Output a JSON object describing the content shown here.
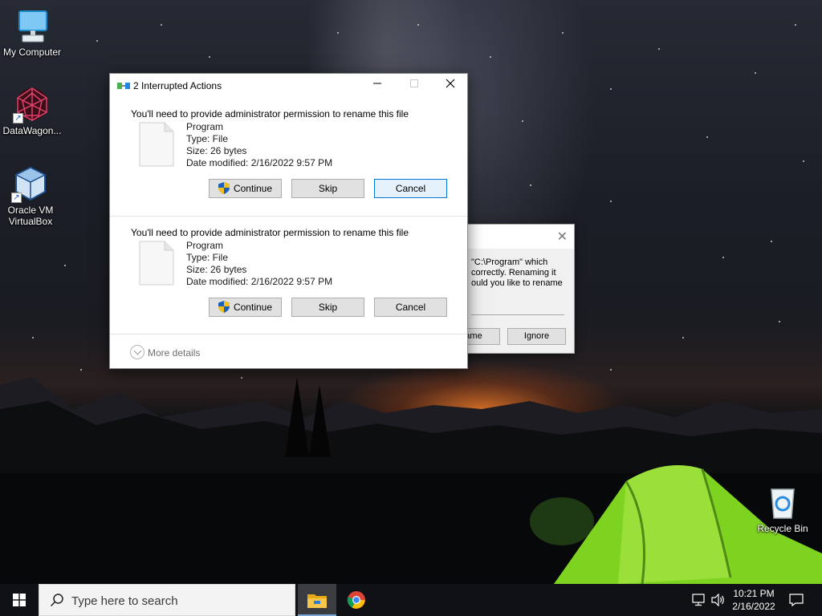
{
  "desktop": {
    "icons": [
      {
        "label": "My Computer"
      },
      {
        "label": "DataWagon..."
      },
      {
        "label": "Oracle VM VirtualBox"
      },
      {
        "label": "Recycle Bin"
      }
    ]
  },
  "background_dialog": {
    "message": "\"C:\\Program\" which correctly.  Renaming it ould you like to rename",
    "rename_button": "ame",
    "ignore_button": "Ignore"
  },
  "dialog": {
    "title": "2 Interrupted Actions",
    "conflicts": [
      {
        "heading": "You'll need to provide administrator permission to rename this file",
        "name": "Program",
        "type": "Type: File",
        "size": "Size: 26 bytes",
        "modified": "Date modified: 2/16/2022 9:57 PM",
        "continue_label": "Continue",
        "skip_label": "Skip",
        "cancel_label": "Cancel"
      },
      {
        "heading": "You'll need to provide administrator permission to rename this file",
        "name": "Program",
        "type": "Type: File",
        "size": "Size: 26 bytes",
        "modified": "Date modified: 2/16/2022 9:57 PM",
        "continue_label": "Continue",
        "skip_label": "Skip",
        "cancel_label": "Cancel"
      }
    ],
    "more_details": "More details"
  },
  "taskbar": {
    "search_placeholder": "Type here to search",
    "apps": [
      {
        "icon": "file-explorer-icon",
        "active": true
      },
      {
        "icon": "chrome-icon",
        "active": false
      }
    ],
    "time": "10:21 PM",
    "date": "2/16/2022"
  },
  "colors": {
    "accent": "#0078d7",
    "button_face": "#e1e1e1",
    "taskbar": "#101114",
    "tent_green": "#7ed321"
  }
}
